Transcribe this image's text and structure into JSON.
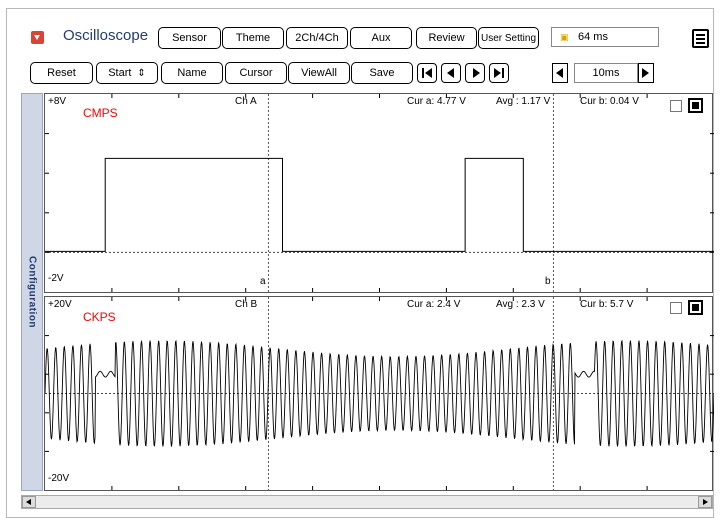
{
  "header": {
    "title": "Oscilloscope",
    "app_icon": "scope-app-icon",
    "menu_icon": "hamburger-menu-icon"
  },
  "toolbar_top": [
    {
      "label": "Sensor"
    },
    {
      "label": "Theme"
    },
    {
      "label": "2Ch/4Ch"
    },
    {
      "label": "Aux"
    },
    {
      "label": "Review"
    },
    {
      "label": "User Setting"
    }
  ],
  "timer": {
    "value": "64 ms",
    "icon": "timer-icon"
  },
  "toolbar_bottom": [
    {
      "label": "Reset"
    },
    {
      "label": "Start"
    },
    {
      "label": "Name"
    },
    {
      "label": "Cursor"
    },
    {
      "label": "ViewAll"
    },
    {
      "label": "Save"
    }
  ],
  "start_arrows": "⇕",
  "playback": {
    "icons": [
      "first-frame-icon",
      "prev-frame-icon",
      "next-frame-icon",
      "last-frame-icon"
    ]
  },
  "timebase": {
    "value": "10ms"
  },
  "config_tab": {
    "label": "Configuration"
  },
  "colors": {
    "signal_name": "#ff0000",
    "trace": "#000000",
    "title": "#223c72"
  },
  "channels": [
    {
      "top_label": "+8V",
      "bottom_label": "-2V",
      "channel": "Ch A",
      "signal": "CMPS",
      "cur_a": "Cur a: 4.77 V",
      "avg": "Avg   : 1.17 V",
      "cur_b": "Cur b: 0.04 V",
      "cursor_a_label": "a",
      "cursor_b_label": "b",
      "range": [
        -2,
        8
      ],
      "waveform": {
        "type": "square",
        "high": 4.75,
        "low": 0.05,
        "pulses": [
          [
            0.09,
            0.355
          ],
          [
            0.628,
            0.715
          ]
        ]
      }
    },
    {
      "top_label": "+20V",
      "bottom_label": "-20V",
      "channel": "Ch B",
      "signal": "CKPS",
      "cur_a": "Cur a: 2.4 V",
      "avg": "Avg   : 2.3 V",
      "cur_b": "Cur b: 5.7 V",
      "range": [
        -20,
        20
      ],
      "waveform": {
        "type": "crank-sine",
        "amplitude": 11,
        "cycles_per_screen": 78,
        "gaps": [
          [
            0.075,
            0.105
          ],
          [
            0.792,
            0.822
          ]
        ]
      }
    }
  ],
  "cursors": {
    "a": 0.334,
    "b": 0.76
  }
}
